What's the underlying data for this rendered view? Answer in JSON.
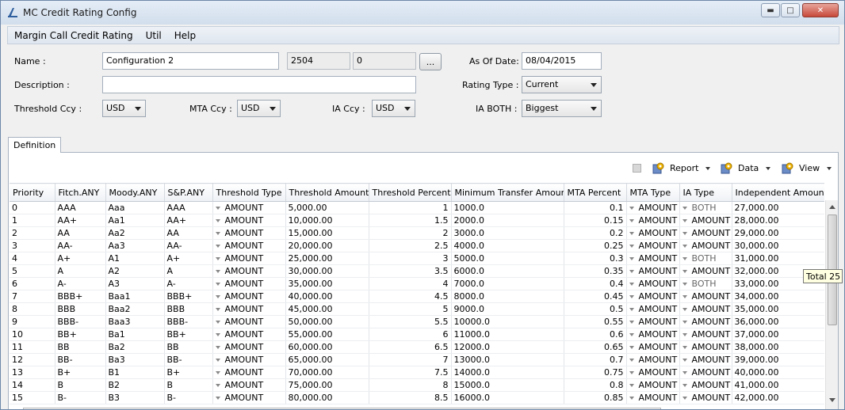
{
  "window": {
    "title": "MC Credit Rating Config"
  },
  "menu": [
    "Margin Call Credit Rating",
    "Util",
    "Help"
  ],
  "form": {
    "name_label": "Name :",
    "name_value": "Configuration 2",
    "id_value": "2504",
    "version_value": "0",
    "dots_label": "...",
    "asof_label": "As Of Date:",
    "asof_value": "08/04/2015",
    "description_label": "Description :",
    "description_value": "",
    "rating_type_label": "Rating Type :",
    "rating_type_value": "Current",
    "threshold_ccy_label": "Threshold Ccy :",
    "threshold_ccy_value": "USD",
    "mta_ccy_label": "MTA Ccy :",
    "mta_ccy_value": "USD",
    "ia_ccy_label": "IA Ccy :",
    "ia_ccy_value": "USD",
    "ia_both_label": "IA BOTH :",
    "ia_both_value": "Biggest"
  },
  "tabs": [
    "Definition"
  ],
  "toolbar": {
    "report": "Report",
    "data": "Data",
    "view": "View"
  },
  "table": {
    "columns": [
      "Priority",
      "Fitch.ANY",
      "Moody.ANY",
      "S&P.ANY",
      "Threshold Type",
      "Threshold Amount",
      "Threshold Percent",
      "Minimum Transfer Amount",
      "MTA Percent",
      "MTA Type",
      "IA Type",
      "Independent Amount"
    ],
    "rows": [
      [
        "0",
        "AAA",
        "Aaa",
        "AAA",
        "AMOUNT",
        "5,000.00",
        "1",
        "1000.0",
        "0.1",
        "AMOUNT",
        "BOTH",
        "27,000.00"
      ],
      [
        "1",
        "AA+",
        "Aa1",
        "AA+",
        "AMOUNT",
        "10,000.00",
        "1.5",
        "2000.0",
        "0.15",
        "AMOUNT",
        "AMOUNT",
        "28,000.00"
      ],
      [
        "2",
        "AA",
        "Aa2",
        "AA",
        "AMOUNT",
        "15,000.00",
        "2",
        "3000.0",
        "0.2",
        "AMOUNT",
        "AMOUNT",
        "29,000.00"
      ],
      [
        "3",
        "AA-",
        "Aa3",
        "AA-",
        "AMOUNT",
        "20,000.00",
        "2.5",
        "4000.0",
        "0.25",
        "AMOUNT",
        "AMOUNT",
        "30,000.00"
      ],
      [
        "4",
        "A+",
        "A1",
        "A+",
        "AMOUNT",
        "25,000.00",
        "3",
        "5000.0",
        "0.3",
        "AMOUNT",
        "BOTH",
        "31,000.00"
      ],
      [
        "5",
        "A",
        "A2",
        "A",
        "AMOUNT",
        "30,000.00",
        "3.5",
        "6000.0",
        "0.35",
        "AMOUNT",
        "AMOUNT",
        "32,000.00"
      ],
      [
        "6",
        "A-",
        "A3",
        "A-",
        "AMOUNT",
        "35,000.00",
        "4",
        "7000.0",
        "0.4",
        "AMOUNT",
        "BOTH",
        "33,000.00"
      ],
      [
        "7",
        "BBB+",
        "Baa1",
        "BBB+",
        "AMOUNT",
        "40,000.00",
        "4.5",
        "8000.0",
        "0.45",
        "AMOUNT",
        "AMOUNT",
        "34,000.00"
      ],
      [
        "8",
        "BBB",
        "Baa2",
        "BBB",
        "AMOUNT",
        "45,000.00",
        "5",
        "9000.0",
        "0.5",
        "AMOUNT",
        "AMOUNT",
        "35,000.00"
      ],
      [
        "9",
        "BBB-",
        "Baa3",
        "BBB-",
        "AMOUNT",
        "50,000.00",
        "5.5",
        "10000.0",
        "0.55",
        "AMOUNT",
        "AMOUNT",
        "36,000.00"
      ],
      [
        "10",
        "BB+",
        "Ba1",
        "BB+",
        "AMOUNT",
        "55,000.00",
        "6",
        "11000.0",
        "0.6",
        "AMOUNT",
        "AMOUNT",
        "37,000.00"
      ],
      [
        "11",
        "BB",
        "Ba2",
        "BB",
        "AMOUNT",
        "60,000.00",
        "6.5",
        "12000.0",
        "0.65",
        "AMOUNT",
        "AMOUNT",
        "38,000.00"
      ],
      [
        "12",
        "BB-",
        "Ba3",
        "BB-",
        "AMOUNT",
        "65,000.00",
        "7",
        "13000.0",
        "0.7",
        "AMOUNT",
        "AMOUNT",
        "39,000.00"
      ],
      [
        "13",
        "B+",
        "B1",
        "B+",
        "AMOUNT",
        "70,000.00",
        "7.5",
        "14000.0",
        "0.75",
        "AMOUNT",
        "AMOUNT",
        "40,000.00"
      ],
      [
        "14",
        "B",
        "B2",
        "B",
        "AMOUNT",
        "75,000.00",
        "8",
        "15000.0",
        "0.8",
        "AMOUNT",
        "AMOUNT",
        "41,000.00"
      ],
      [
        "15",
        "B-",
        "B3",
        "B-",
        "AMOUNT",
        "80,000.00",
        "8.5",
        "16000.0",
        "0.85",
        "AMOUNT",
        "AMOUNT",
        "42,000.00"
      ]
    ]
  },
  "tooltip": "Total 25",
  "icons": {
    "app": "app-icon",
    "toolbar": "gear-icon"
  },
  "colors": {
    "titlebar": "#d2deec",
    "close": "#c7493a",
    "header": "#eef1f5",
    "tooltip_bg": "#ffffe1"
  }
}
